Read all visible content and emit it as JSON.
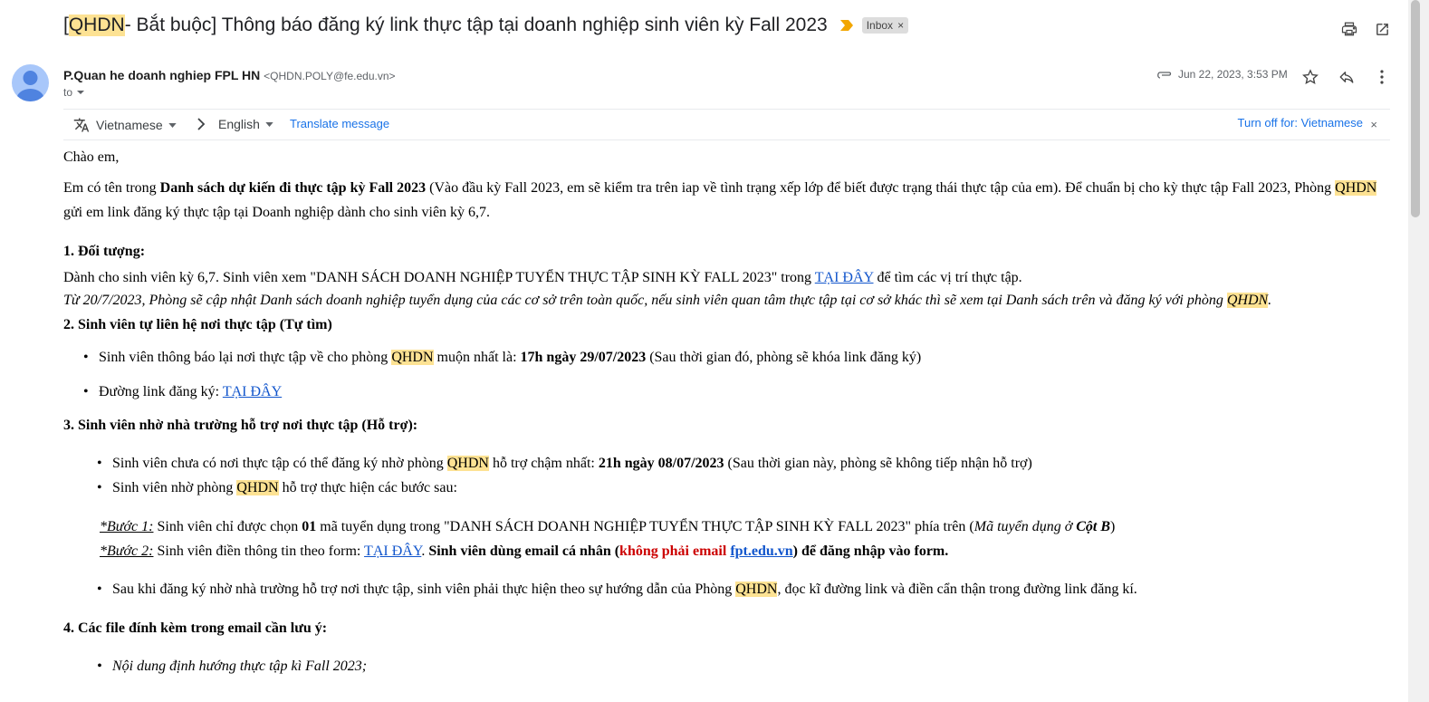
{
  "subject": {
    "prefix": "[",
    "highlight": "QHDN",
    "rest": " - Bắt buộc] Thông báo đăng ký link thực tập tại doanh nghiệp sinh viên kỳ Fall 2023",
    "label": "Inbox",
    "label_remove": "×"
  },
  "toolbar": {
    "print_icon": "print-icon",
    "popout_icon": "open-in-new-icon"
  },
  "header": {
    "sender_name": "P.Quan he doanh nghiep FPL HN",
    "sender_email": "<QHDN.POLY@fe.edu.vn>",
    "to": "to",
    "date": "Jun 22, 2023, 3:53 PM"
  },
  "translate": {
    "from_lang": "Vietnamese",
    "to_lang": "English",
    "translate_link": "Translate message",
    "turn_off": "Turn off for: Vietnamese",
    "close": "×"
  },
  "email": {
    "greeting": "Chào em,",
    "intro_1": "Em có tên trong ",
    "intro_bold": "Danh sách dự kiến đi thực tập kỳ Fall 2023",
    "intro_2": " (Vào đầu kỳ Fall 2023, em sẽ kiểm tra trên iap về tình trạng xếp lớp để biết được trạng thái thực tập của em). Để chuẩn bị cho kỳ thực tập Fall 2023, Phòng ",
    "qhdn": "QHDN",
    "intro_3": " gửi em link đăng ký thực tập tại Doanh nghiệp dành cho sinh viên kỳ 6,7.",
    "s1_title": "1. Đối tượng:",
    "s1_text_1": "Dành cho sinh viên kỳ 6,7. Sinh viên xem \"DANH SÁCH DOANH NGHIỆP TUYỂN THỰC TẬP SINH KỲ FALL 2023\" trong ",
    "s1_link": " TẠI ĐÂY",
    "s1_text_2": " để tìm các vị trí thực tập.",
    "s1_italic_1": "Từ 20/7/2023, Phòng sẽ cập nhật Danh sách doanh nghiệp tuyển dụng của các cơ sở trên toàn quốc, nếu sinh viên quan tâm thực tập tại cơ sở khác thì sẽ xem tại Danh sách trên và đăng ký với phòng ",
    "s1_italic_2": ".",
    "s2_num": "2",
    "s2_title": ". Sinh viên tự liên hệ nơi thực tập (Tự tìm)",
    "s2_b1_1": "Sinh viên thông báo lại nơi thực tập về cho phòng ",
    "s2_b1_2": " muộn nhất là: ",
    "s2_b1_bold": "17h ngày 29/07/2023",
    "s2_b1_3": " (Sau thời gian đó, phòng sẽ khóa link đăng ký)",
    "s2_b2_1": "Đường link đăng ký: ",
    "s2_b2_link": "TẠI ĐÂY",
    "s3_title": "3. Sinh viên nhờ nhà trường hỗ trợ nơi thực tập (Hỗ trợ):",
    "s3_b1_1": "Sinh viên chưa có nơi thực tập có thể đăng ký nhờ phòng ",
    "s3_b1_2": " hỗ trợ chậm nhất: ",
    "s3_b1_bold": "21h ngày 08/07/2023",
    "s3_b1_3": " (Sau thời gian này, phòng sẽ không tiếp nhận hỗ trợ)",
    "s3_b2_1": "Sinh viên nhờ phòng ",
    "s3_b2_2": " hỗ trợ thực hiện các bước sau:",
    "step1_label": "*Bước 1:",
    "step1_1": " Sinh viên chỉ được chọn ",
    "step1_bold": "01",
    "step1_2": " mã tuyển dụng trong \"DANH SÁCH DOANH NGHIỆP TUYỂN THỰC TẬP SINH KỲ FALL 2023\" phía trên (",
    "step1_italic": "Mã tuyển dụng ở ",
    "step1_italic_bold": "Cột B",
    "step1_3": ")",
    "step2_label": "*Bước 2:",
    "step2_1": " Sinh viên điền thông tin theo form: ",
    "step2_link": "TẠI ĐÂY",
    "step2_2": ". ",
    "step2_bold_1": "Sinh viên dùng email cá nhân (",
    "step2_red": "không phải email ",
    "step2_domain": "fpt.edu.vn",
    "step2_bold_2": ") để đăng nhập vào form.",
    "s3_b3_1": "Sau khi đăng ký nhờ nhà trường hỗ trợ nơi thực tập, sinh viên phải thực hiện theo sự hướng dẫn của Phòng ",
    "s3_b3_2": ", đọc kĩ đường link và điền cẩn thận trong đường link đăng kí.",
    "s4_title": "4. Các file đính kèm trong email cần lưu ý:",
    "s4_b1": "Nội dung định hướng thực tập kì Fall 2023;"
  }
}
